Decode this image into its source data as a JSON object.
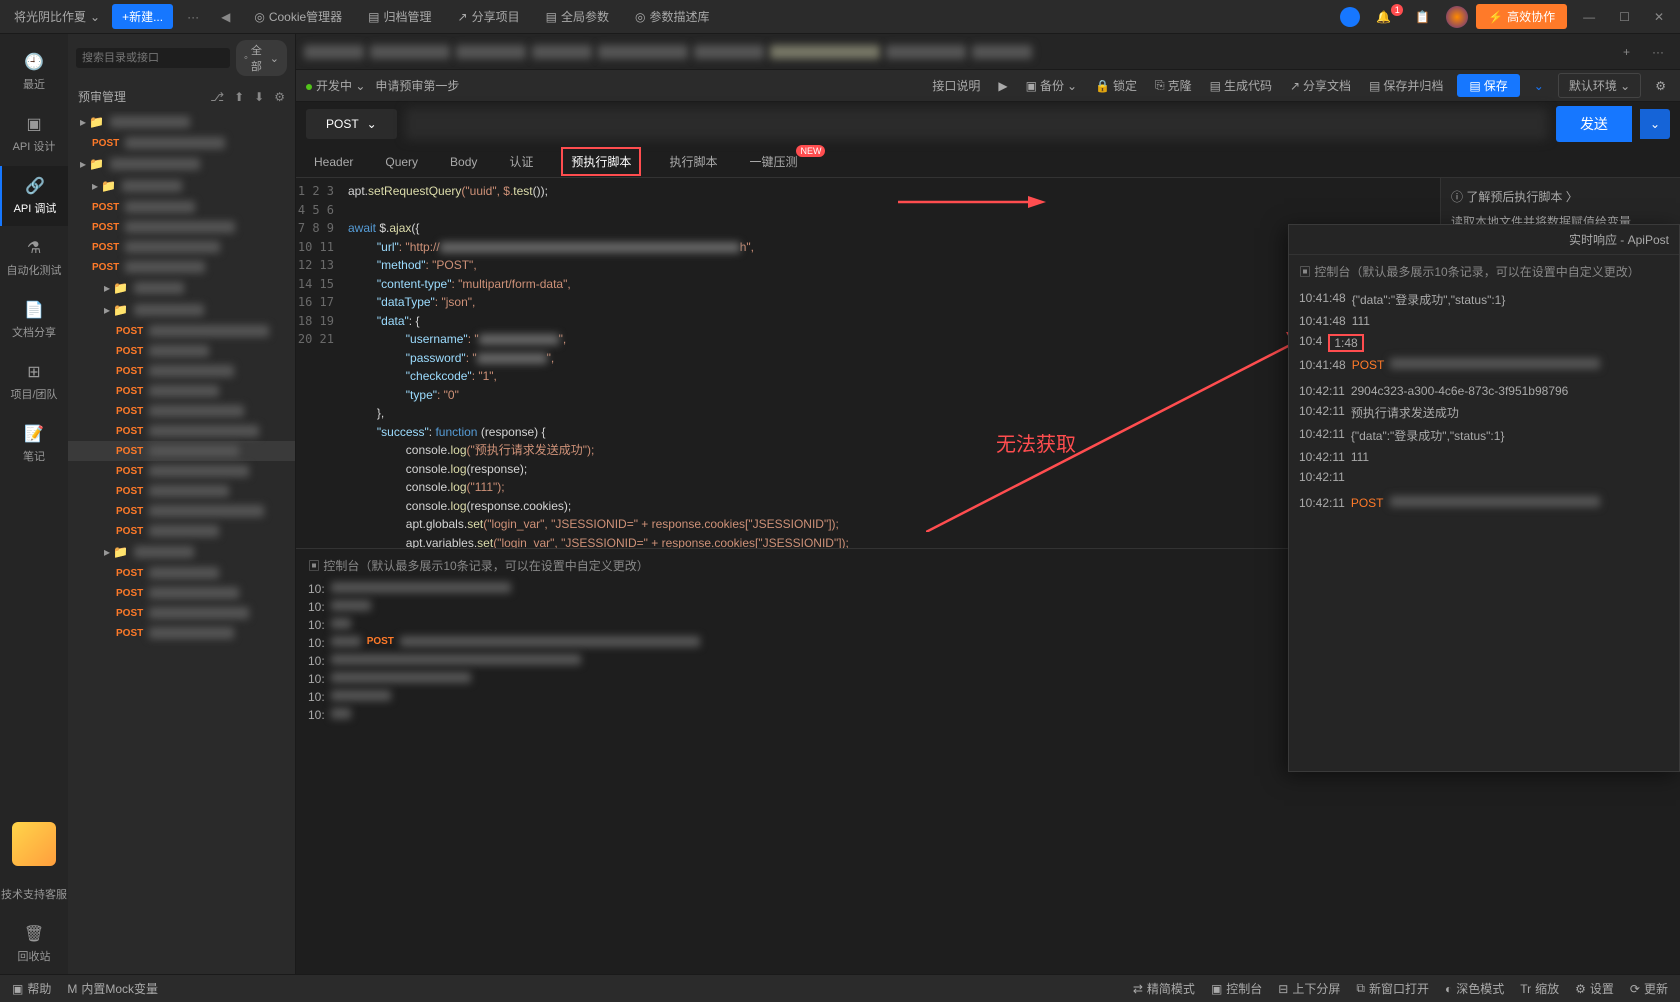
{
  "titlebar": {
    "workspace": "将光阴比作夏",
    "newBtn": "+新建...",
    "moreBtn": "···",
    "backIcon": "◀",
    "cookieMgr": "Cookie管理器",
    "archive": "归档管理",
    "shareProj": "分享项目",
    "globalParams": "全局参数",
    "paramDesc": "参数描述库",
    "collab": "高效协作"
  },
  "rail": {
    "recent": "最近",
    "apiDesign": "API 设计",
    "apiDebug": "API 调试",
    "autoTest": "自动化测试",
    "docShare": "文档分享",
    "projTeam": "项目/团队",
    "notes": "笔记",
    "support": "技术支持客服",
    "recycle": "回收站"
  },
  "tree": {
    "searchPlaceholder": "搜索目录或接口",
    "filterAll": "全部",
    "title": "预审管理"
  },
  "httpTag": "POST",
  "subtoolbar": {
    "dev": "开发中",
    "tabName": "申请预审第一步",
    "apiDesc": "接口说明",
    "backup": "备份",
    "lock": "锁定",
    "clone": "克隆",
    "genCode": "生成代码",
    "shareDoc": "分享文档",
    "saveArchive": "保存并归档",
    "save": "保存",
    "defaultEnv": "默认环境"
  },
  "urlbar": {
    "method": "POST",
    "send": "发送"
  },
  "reqTabs": {
    "header": "Header",
    "query": "Query",
    "body": "Body",
    "auth": "认证",
    "preScript": "预执行脚本",
    "postScript": "执行脚本",
    "loadTest": "一键压测",
    "newBadge": "NEW"
  },
  "code": {
    "lines": [
      1,
      2,
      3,
      4,
      5,
      6,
      7,
      8,
      9,
      10,
      11,
      12,
      13,
      14,
      15,
      16,
      17,
      18,
      19,
      20,
      21
    ],
    "l1a": "apt.",
    "l1b": "setRequestQuery",
    "l1c": "(\"uuid\", $.",
    "l1d": "test",
    "l1e": "());",
    "l3a": "await",
    "l3b": " $.",
    "l3c": "ajax",
    "l3d": "({",
    "l4k": "\"url\"",
    "l4v": ": \"http://",
    "l4end": "h\",",
    "l5k": "\"method\"",
    "l5v": ": \"POST\",",
    "l6k": "\"content-type\"",
    "l6v": ": \"multipart/form-data\",",
    "l7k": "\"dataType\"",
    "l7v": ": \"json\",",
    "l8k": "\"data\"",
    "l8v": ": {",
    "l9k": "\"username\"",
    "l9v": ": \"",
    "l9end": "\",",
    "l10k": "\"password\"",
    "l10v": ": \"",
    "l10end": "\",",
    "l11k": "\"checkcode\"",
    "l11v": ": \"1\",",
    "l12k": "\"type\"",
    "l12v": ": \"0\"",
    "l13": "},",
    "l14k": "\"success\"",
    "l14a": ": ",
    "l14b": "function",
    "l14c": " (response) {",
    "l15a": "console.",
    "l15b": "log",
    "l15c": "(\"预执行请求发送成功\");",
    "l16a": "console.",
    "l16b": "log",
    "l16c": "(response);",
    "l17a": "console.",
    "l17b": "log",
    "l17c": "(\"111\");",
    "l18a": "console.",
    "l18b": "log",
    "l18c": "(response.cookies);",
    "l19a": "apt.globals.",
    "l19b": "set",
    "l19c": "(\"login_var\", \"JSESSIONID=\" + response.cookies[\"JSESSIONID\"]);",
    "l20a": "apt.variables.",
    "l20b": "set",
    "l20c": "(\"login_var\", \"JSESSIONID=\" + response.cookies[\"JSESSIONID\"]);",
    "l21": "}"
  },
  "rightHelp": {
    "link": "了解预后执行脚本",
    "desc": "读取本地文件并将数据赋值给变量"
  },
  "console": {
    "title": "控制台（默认最多展示10条记录，可以在设置中自定义更改）",
    "prefix": "10:"
  },
  "rtPanel": {
    "title": "实时响应 - ApiPost",
    "consoleTitle": "控制台（默认最多展示10条记录，可以在设置中自定义更改）",
    "l1t": "10:41:48",
    "l1v": "{\"data\":\"登录成功\",\"status\":1}",
    "l2t": "10:41:48",
    "l2v": "111",
    "l3t": "10:41:48",
    "l4t": "10:41:48",
    "l4p": "POST",
    "l5t": "10:42:11",
    "l5v": "2904c323-a300-4c6e-873c-3f951b98796",
    "l6t": "10:42:11",
    "l6v": "预执行请求发送成功",
    "l7t": "10:42:11",
    "l7v": "{\"data\":\"登录成功\",\"status\":1}",
    "l8t": "10:42:11",
    "l8v": "111",
    "l9t": "10:42:11",
    "l10t": "10:42:11",
    "l10p": "POST"
  },
  "annotation": {
    "text": "无法获取"
  },
  "statusbar": {
    "help": "帮助",
    "mock": "内置Mock变量",
    "simple": "精简模式",
    "console": "控制台",
    "splitV": "上下分屏",
    "newWin": "新窗口打开",
    "dark": "深色模式",
    "zoom": "缩放",
    "settings": "设置",
    "update": "更新"
  }
}
